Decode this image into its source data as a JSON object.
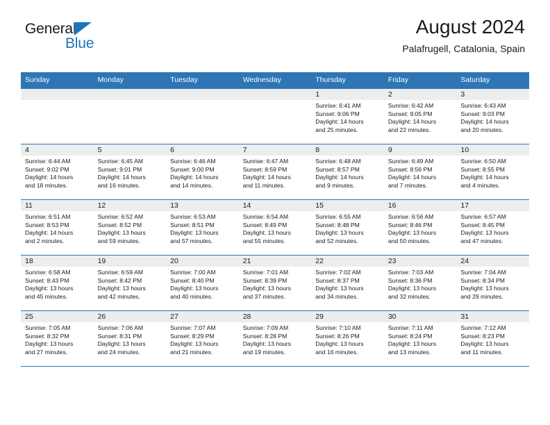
{
  "brand": {
    "name_top": "General",
    "name_bottom": "Blue",
    "accent_color": "#1b75bb",
    "flag_icon": "triangle-flag-icon"
  },
  "header": {
    "title": "August 2024",
    "subtitle": "Palafrugell, Catalonia, Spain"
  },
  "calendar": {
    "header_bg": "#2e75b6",
    "daynum_bg": "#eceded",
    "weekdays": [
      "Sunday",
      "Monday",
      "Tuesday",
      "Wednesday",
      "Thursday",
      "Friday",
      "Saturday"
    ],
    "weeks": [
      [
        {
          "day": "",
          "empty": true
        },
        {
          "day": "",
          "empty": true
        },
        {
          "day": "",
          "empty": true
        },
        {
          "day": "",
          "empty": true
        },
        {
          "day": "1",
          "sunrise": "Sunrise: 6:41 AM",
          "sunset": "Sunset: 9:06 PM",
          "daylight_line1": "Daylight: 14 hours",
          "daylight_line2": "and 25 minutes."
        },
        {
          "day": "2",
          "sunrise": "Sunrise: 6:42 AM",
          "sunset": "Sunset: 9:05 PM",
          "daylight_line1": "Daylight: 14 hours",
          "daylight_line2": "and 22 minutes."
        },
        {
          "day": "3",
          "sunrise": "Sunrise: 6:43 AM",
          "sunset": "Sunset: 9:03 PM",
          "daylight_line1": "Daylight: 14 hours",
          "daylight_line2": "and 20 minutes."
        }
      ],
      [
        {
          "day": "4",
          "sunrise": "Sunrise: 6:44 AM",
          "sunset": "Sunset: 9:02 PM",
          "daylight_line1": "Daylight: 14 hours",
          "daylight_line2": "and 18 minutes."
        },
        {
          "day": "5",
          "sunrise": "Sunrise: 6:45 AM",
          "sunset": "Sunset: 9:01 PM",
          "daylight_line1": "Daylight: 14 hours",
          "daylight_line2": "and 16 minutes."
        },
        {
          "day": "6",
          "sunrise": "Sunrise: 6:46 AM",
          "sunset": "Sunset: 9:00 PM",
          "daylight_line1": "Daylight: 14 hours",
          "daylight_line2": "and 14 minutes."
        },
        {
          "day": "7",
          "sunrise": "Sunrise: 6:47 AM",
          "sunset": "Sunset: 8:59 PM",
          "daylight_line1": "Daylight: 14 hours",
          "daylight_line2": "and 11 minutes."
        },
        {
          "day": "8",
          "sunrise": "Sunrise: 6:48 AM",
          "sunset": "Sunset: 8:57 PM",
          "daylight_line1": "Daylight: 14 hours",
          "daylight_line2": "and 9 minutes."
        },
        {
          "day": "9",
          "sunrise": "Sunrise: 6:49 AM",
          "sunset": "Sunset: 8:56 PM",
          "daylight_line1": "Daylight: 14 hours",
          "daylight_line2": "and 7 minutes."
        },
        {
          "day": "10",
          "sunrise": "Sunrise: 6:50 AM",
          "sunset": "Sunset: 8:55 PM",
          "daylight_line1": "Daylight: 14 hours",
          "daylight_line2": "and 4 minutes."
        }
      ],
      [
        {
          "day": "11",
          "sunrise": "Sunrise: 6:51 AM",
          "sunset": "Sunset: 8:53 PM",
          "daylight_line1": "Daylight: 14 hours",
          "daylight_line2": "and 2 minutes."
        },
        {
          "day": "12",
          "sunrise": "Sunrise: 6:52 AM",
          "sunset": "Sunset: 8:52 PM",
          "daylight_line1": "Daylight: 13 hours",
          "daylight_line2": "and 59 minutes."
        },
        {
          "day": "13",
          "sunrise": "Sunrise: 6:53 AM",
          "sunset": "Sunset: 8:51 PM",
          "daylight_line1": "Daylight: 13 hours",
          "daylight_line2": "and 57 minutes."
        },
        {
          "day": "14",
          "sunrise": "Sunrise: 6:54 AM",
          "sunset": "Sunset: 8:49 PM",
          "daylight_line1": "Daylight: 13 hours",
          "daylight_line2": "and 55 minutes."
        },
        {
          "day": "15",
          "sunrise": "Sunrise: 6:55 AM",
          "sunset": "Sunset: 8:48 PM",
          "daylight_line1": "Daylight: 13 hours",
          "daylight_line2": "and 52 minutes."
        },
        {
          "day": "16",
          "sunrise": "Sunrise: 6:56 AM",
          "sunset": "Sunset: 8:46 PM",
          "daylight_line1": "Daylight: 13 hours",
          "daylight_line2": "and 50 minutes."
        },
        {
          "day": "17",
          "sunrise": "Sunrise: 6:57 AM",
          "sunset": "Sunset: 8:45 PM",
          "daylight_line1": "Daylight: 13 hours",
          "daylight_line2": "and 47 minutes."
        }
      ],
      [
        {
          "day": "18",
          "sunrise": "Sunrise: 6:58 AM",
          "sunset": "Sunset: 8:43 PM",
          "daylight_line1": "Daylight: 13 hours",
          "daylight_line2": "and 45 minutes."
        },
        {
          "day": "19",
          "sunrise": "Sunrise: 6:59 AM",
          "sunset": "Sunset: 8:42 PM",
          "daylight_line1": "Daylight: 13 hours",
          "daylight_line2": "and 42 minutes."
        },
        {
          "day": "20",
          "sunrise": "Sunrise: 7:00 AM",
          "sunset": "Sunset: 8:40 PM",
          "daylight_line1": "Daylight: 13 hours",
          "daylight_line2": "and 40 minutes."
        },
        {
          "day": "21",
          "sunrise": "Sunrise: 7:01 AM",
          "sunset": "Sunset: 8:39 PM",
          "daylight_line1": "Daylight: 13 hours",
          "daylight_line2": "and 37 minutes."
        },
        {
          "day": "22",
          "sunrise": "Sunrise: 7:02 AM",
          "sunset": "Sunset: 8:37 PM",
          "daylight_line1": "Daylight: 13 hours",
          "daylight_line2": "and 34 minutes."
        },
        {
          "day": "23",
          "sunrise": "Sunrise: 7:03 AM",
          "sunset": "Sunset: 8:36 PM",
          "daylight_line1": "Daylight: 13 hours",
          "daylight_line2": "and 32 minutes."
        },
        {
          "day": "24",
          "sunrise": "Sunrise: 7:04 AM",
          "sunset": "Sunset: 8:34 PM",
          "daylight_line1": "Daylight: 13 hours",
          "daylight_line2": "and 29 minutes."
        }
      ],
      [
        {
          "day": "25",
          "sunrise": "Sunrise: 7:05 AM",
          "sunset": "Sunset: 8:32 PM",
          "daylight_line1": "Daylight: 13 hours",
          "daylight_line2": "and 27 minutes."
        },
        {
          "day": "26",
          "sunrise": "Sunrise: 7:06 AM",
          "sunset": "Sunset: 8:31 PM",
          "daylight_line1": "Daylight: 13 hours",
          "daylight_line2": "and 24 minutes."
        },
        {
          "day": "27",
          "sunrise": "Sunrise: 7:07 AM",
          "sunset": "Sunset: 8:29 PM",
          "daylight_line1": "Daylight: 13 hours",
          "daylight_line2": "and 21 minutes."
        },
        {
          "day": "28",
          "sunrise": "Sunrise: 7:09 AM",
          "sunset": "Sunset: 8:28 PM",
          "daylight_line1": "Daylight: 13 hours",
          "daylight_line2": "and 19 minutes."
        },
        {
          "day": "29",
          "sunrise": "Sunrise: 7:10 AM",
          "sunset": "Sunset: 8:26 PM",
          "daylight_line1": "Daylight: 13 hours",
          "daylight_line2": "and 16 minutes."
        },
        {
          "day": "30",
          "sunrise": "Sunrise: 7:11 AM",
          "sunset": "Sunset: 8:24 PM",
          "daylight_line1": "Daylight: 13 hours",
          "daylight_line2": "and 13 minutes."
        },
        {
          "day": "31",
          "sunrise": "Sunrise: 7:12 AM",
          "sunset": "Sunset: 8:23 PM",
          "daylight_line1": "Daylight: 13 hours",
          "daylight_line2": "and 11 minutes."
        }
      ]
    ]
  }
}
